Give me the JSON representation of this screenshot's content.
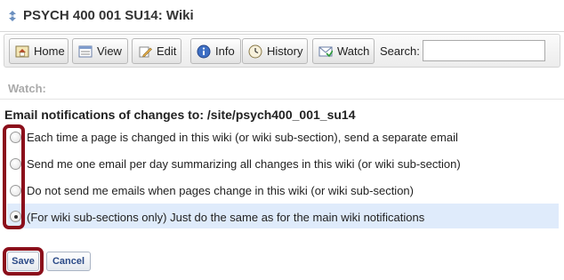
{
  "app": {
    "title": "PSYCH 400 001 SU14: Wiki"
  },
  "toolbar": {
    "buttons": [
      {
        "label": "Home",
        "icon": "home-icon"
      },
      {
        "label": "View",
        "icon": "view-icon"
      },
      {
        "label": "Edit",
        "icon": "edit-icon"
      },
      {
        "label": "Info",
        "icon": "info-icon"
      },
      {
        "label": "History",
        "icon": "history-icon"
      },
      {
        "label": "Watch",
        "icon": "watch-icon"
      }
    ],
    "search_label": "Search:",
    "search_value": ""
  },
  "watch": {
    "label": "Watch:"
  },
  "notifications": {
    "heading": "Email notifications of changes to: /site/psych400_001_su14",
    "options": [
      {
        "label": "Each time a page is changed in this wiki (or wiki sub-section), send a separate email",
        "checked": false
      },
      {
        "label": "Send me one email per day summarizing all changes in this wiki (or wiki sub-section)",
        "checked": false
      },
      {
        "label": "Do not send me emails when pages change in this wiki (or wiki sub-section)",
        "checked": false
      },
      {
        "label": "(For wiki sub-sections only) Just do the same as for the main wiki notifications",
        "checked": true
      }
    ]
  },
  "actions": {
    "save_label": "Save",
    "cancel_label": "Cancel"
  },
  "colors": {
    "highlight": "#8b0f1b",
    "selected_row": "#dfebfb",
    "button_text": "#2b4a87"
  }
}
